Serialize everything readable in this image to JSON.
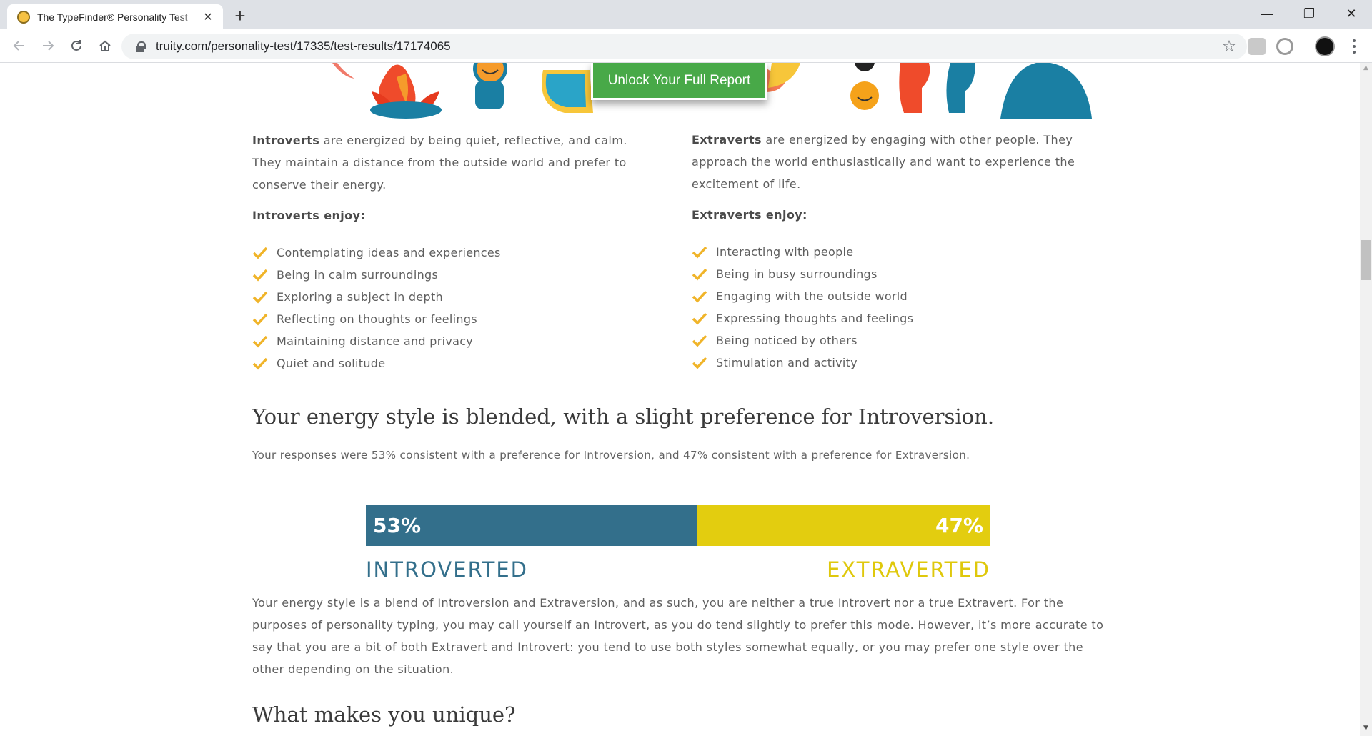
{
  "browser": {
    "tab_title": "The TypeFinder® Personality Test",
    "url": "truity.com/personality-test/17335/test-results/17174065",
    "tab_close": "✕",
    "new_tab": "+",
    "minimize": "—",
    "restore": "❐",
    "close": "✕"
  },
  "hero": {
    "unlock_label": "Unlock Your Full Report"
  },
  "introverts": {
    "term": "Introverts",
    "description": " are energized by being quiet, reflective, and calm. They maintain a distance from the outside world and prefer to conserve their energy.",
    "enjoy_title": "Introverts enjoy:",
    "items": [
      "Contemplating ideas and experiences",
      "Being in calm surroundings",
      "Exploring a subject in depth",
      "Reflecting on thoughts or feelings",
      "Maintaining distance and privacy",
      "Quiet and solitude"
    ]
  },
  "extraverts": {
    "term": "Extraverts",
    "description": " are energized by engaging with other people. They approach the world enthusiastically and want to experience the excitement of life.",
    "enjoy_title": "Extraverts enjoy:",
    "items": [
      "Interacting with people",
      "Being in busy surroundings",
      "Engaging with the outside world",
      "Expressing thoughts and feelings",
      "Being noticed by others",
      "Stimulation and activity"
    ]
  },
  "result": {
    "heading": "Your energy style is blended, with a slight preference for Introversion.",
    "summary": "Your responses were 53% consistent with a preference for Introversion, and 47% consistent with a preference for Extraversion.",
    "intro_percent_label": "53%",
    "extra_percent_label": "47%",
    "intro_fraction": 0.53,
    "extra_fraction": 0.47,
    "intro_label": "INTROVERTED",
    "extra_label": "EXTRAVERTED",
    "intro_color": "#336f8b",
    "extra_color": "#e3cd0f",
    "explanation": "Your energy style is a blend of Introversion and Extraversion, and as such, you are neither a true Introvert nor a true Extravert.  For the purposes of personality typing, you may call yourself an Introvert, as you do tend slightly to prefer this mode. However, it’s more accurate to say that you are a bit of both Extravert and Introvert: you tend to use both styles somewhat equally, or you may prefer one style over the other depending on the situation."
  },
  "next_section": {
    "heading": "What makes you unique?"
  },
  "icons": {
    "check": "check-icon",
    "accent": "#f0b429"
  }
}
